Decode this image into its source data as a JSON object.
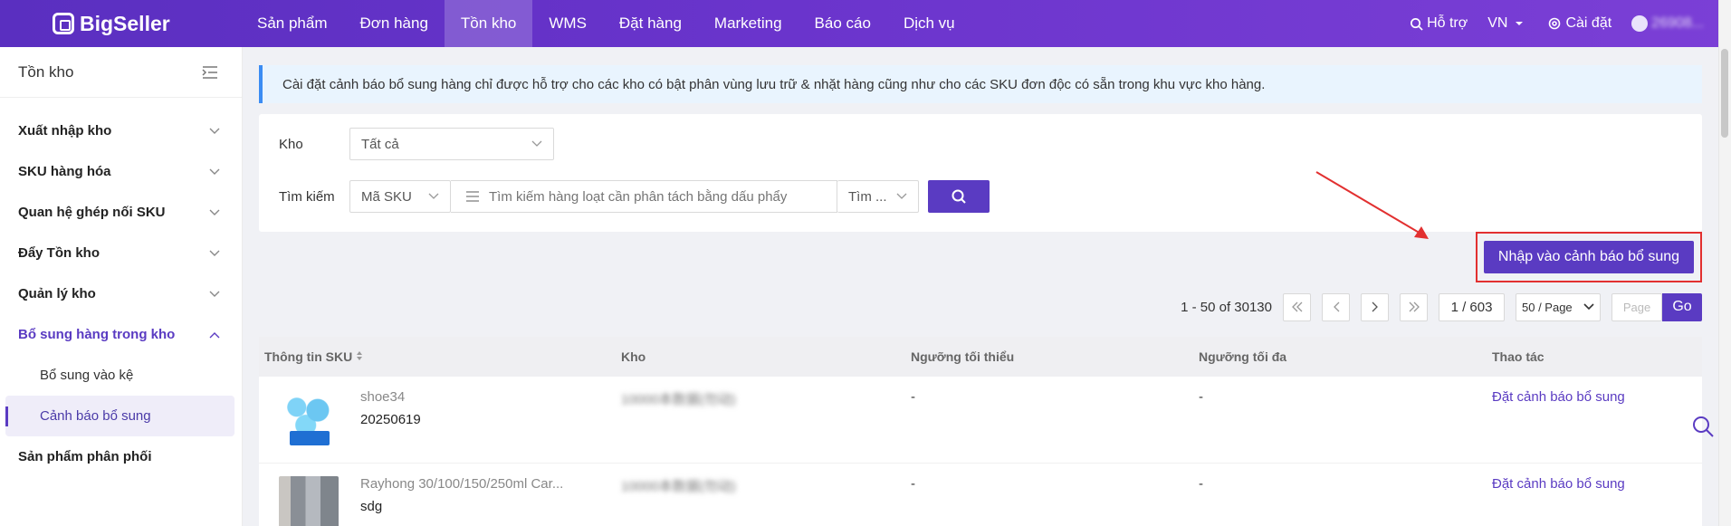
{
  "app": {
    "brand": "BigSeller"
  },
  "topnav": {
    "items": [
      "Sản phẩm",
      "Đơn hàng",
      "Tồn kho",
      "WMS",
      "Đặt hàng",
      "Marketing",
      "Báo cáo",
      "Dịch vụ"
    ],
    "active": "Tồn kho",
    "help": "Hỗ trợ",
    "lang": "VN",
    "settings": "Cài đặt",
    "user": "26908..."
  },
  "sidebar": {
    "title": "Tồn kho",
    "items": [
      {
        "label": "Xuất nhập kho"
      },
      {
        "label": "SKU hàng hóa"
      },
      {
        "label": "Quan hệ ghép nối SKU"
      },
      {
        "label": "Đẩy Tồn kho"
      },
      {
        "label": "Quản lý kho"
      },
      {
        "label": "Bổ sung hàng trong kho"
      },
      {
        "label": "Sản phẩm phân phối"
      }
    ],
    "sub_items": [
      {
        "label": "Bổ sung vào kệ"
      },
      {
        "label": "Cảnh báo bổ sung"
      }
    ]
  },
  "notice": "Cài đặt cảnh báo bổ sung hàng chỉ được hỗ trợ cho các kho có bật phân vùng lưu trữ & nhặt hàng cũng như cho các SKU đơn độc có sẵn trong khu vực kho hàng.",
  "filters": {
    "warehouse_label": "Kho",
    "warehouse_value": "Tất cả",
    "search_label": "Tìm kiếm",
    "search_type": "Mã SKU",
    "search_placeholder": "Tìm kiếm hàng loạt cần phân tách bằng dấu phẩy",
    "search_mode": "Tìm ..."
  },
  "actions": {
    "import_button": "Nhập vào cảnh báo bổ sung"
  },
  "pagination": {
    "summary": "1 - 50 of 30130",
    "current": "1 / 603",
    "page_size": "50 / Page",
    "page_placeholder": "Page",
    "go": "Go"
  },
  "table": {
    "headers": [
      "Thông tin SKU",
      "Kho",
      "Ngưỡng tối thiểu",
      "Ngưỡng tối đa",
      "Thao tác"
    ],
    "rows": [
      {
        "name": "shoe34",
        "code": "20250619",
        "warehouse": "10000本数据(勿动)",
        "min": "-",
        "max": "-",
        "action": "Đặt cảnh báo bổ sung"
      },
      {
        "name": "Rayhong 30/100/150/250ml Car...",
        "code": "sdg",
        "warehouse": "10000本数据(勿动)",
        "min": "-",
        "max": "-",
        "action": "Đặt cảnh báo bổ sung"
      }
    ]
  },
  "colors": {
    "brand": "#5a3bc2",
    "highlight": "#e23030",
    "notice_bg": "#e9f4fe"
  }
}
